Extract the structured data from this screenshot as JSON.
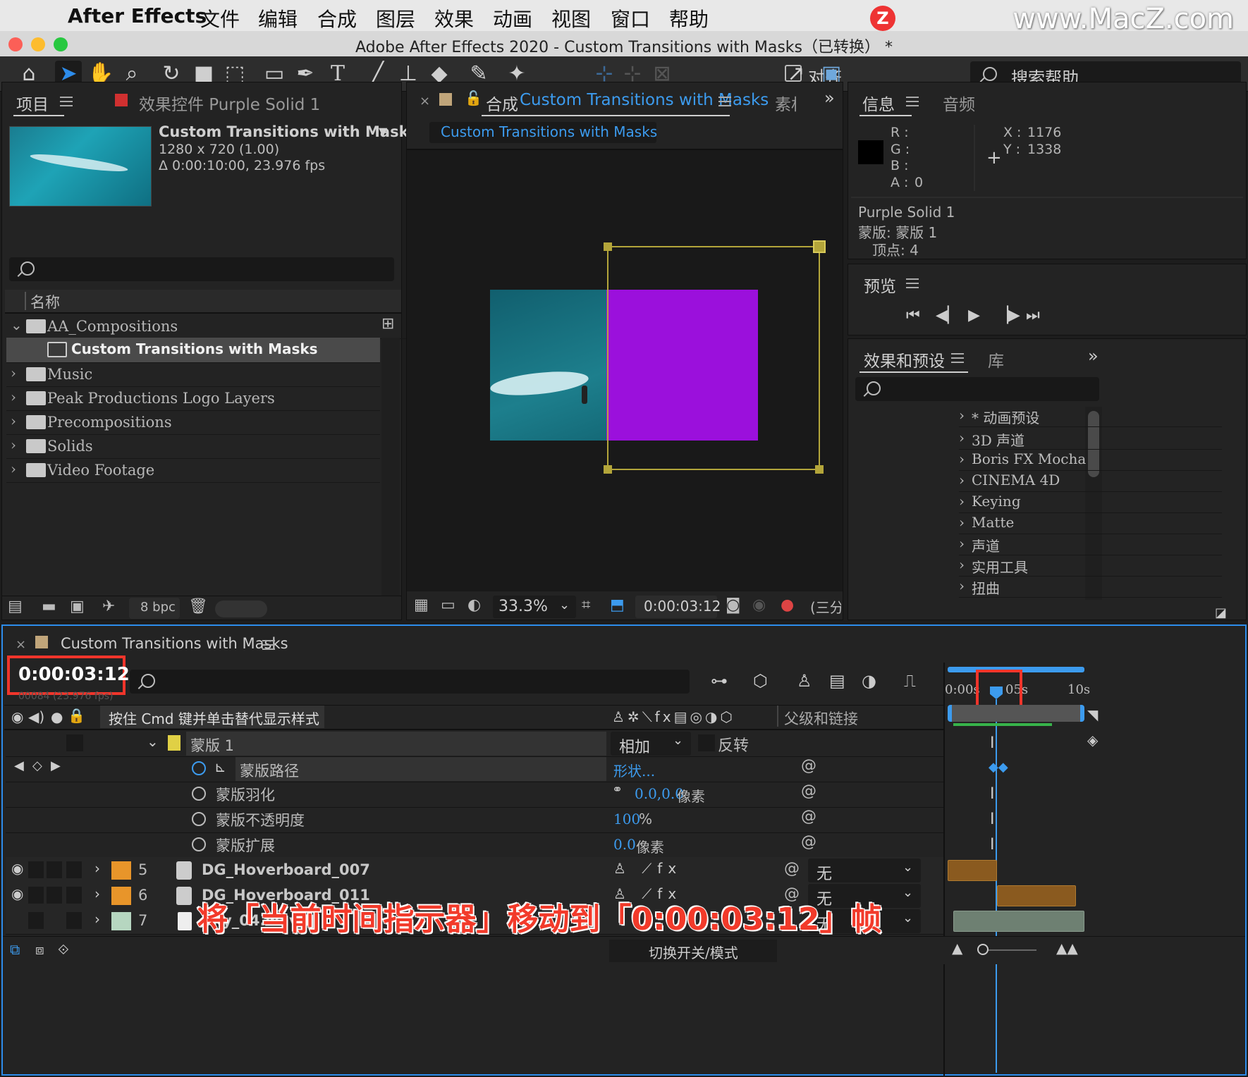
{
  "menubar": {
    "app_name": "After Effects",
    "items": [
      "文件",
      "编辑",
      "合成",
      "图层",
      "效果",
      "动画",
      "视图",
      "窗口",
      "帮助"
    ]
  },
  "watermark": {
    "badge": "Z",
    "text": "www.MacZ.com"
  },
  "window": {
    "title": "Adobe After Effects 2020 - Custom Transitions with Masks（已转换） *"
  },
  "toolbar": {
    "align_label": "对齐",
    "search_help_label": "搜索帮助"
  },
  "project_panel": {
    "tab_label": "项目",
    "effects_tab_label": "效果控件 Purple Solid 1",
    "item_name": "Custom Transitions with Masks",
    "item_dims": "1280 x 720 (1.00)",
    "item_duration": "Δ 0:00:10:00, 23.976 fps",
    "column_name": "名称",
    "folders": [
      {
        "name": "AA_Compositions",
        "expanded": true
      },
      {
        "name": "Music",
        "expanded": false
      },
      {
        "name": "Peak Productions Logo Layers",
        "expanded": false
      },
      {
        "name": "Precompositions",
        "expanded": false
      },
      {
        "name": "Solids",
        "expanded": false
      },
      {
        "name": "Video Footage",
        "expanded": false
      }
    ],
    "selected_item": "Custom Transitions with Masks",
    "bpc": "8 bpc"
  },
  "comp_panel": {
    "tab_prefix": "合成",
    "tab_name": "Custom Transitions with Masks",
    "tab_overflow": "素材",
    "breadcrumb": "Custom Transitions with Masks",
    "zoom": "33.3%",
    "timecode": "0:00:03:12",
    "view_label": "(三分"
  },
  "info_panel": {
    "tab_label": "信息",
    "audio_tab_label": "音频",
    "r_label": "R :",
    "g_label": "G :",
    "b_label": "B :",
    "a_label": "A :",
    "a_value": "0",
    "x_label": "X :",
    "x_value": "1176",
    "y_label": "Y :",
    "y_value": "1338",
    "layer_name": "Purple Solid 1",
    "mask_line": "蒙版: 蒙版 1",
    "vertex_line": "顶点: 4"
  },
  "preview_panel": {
    "tab_label": "预览"
  },
  "effects_panel": {
    "tab_label": "效果和预设",
    "library_tab_label": "库",
    "items": [
      "* 动画预设",
      "3D 声道",
      "Boris FX Mocha",
      "CINEMA 4D",
      "Keying",
      "Matte",
      "声道",
      "实用工具",
      "扭曲"
    ]
  },
  "timeline": {
    "comp_name": "Custom Transitions with Masks",
    "current_time": "0:00:03:12",
    "frame_info": "00084 (23.976 fps)",
    "tooltip": "按住 Cmd 键并单击替代显示样式",
    "parent_header": "父级和链接",
    "ruler": {
      "start": "0:00s",
      "mid": "05s",
      "end": "10s"
    },
    "mask": {
      "name": "蒙版 1",
      "mode": "相加",
      "invert_label": "反转",
      "properties": [
        {
          "name": "蒙版路径",
          "value": "形状..."
        },
        {
          "name": "蒙版羽化",
          "value": "0.0,0.0",
          "unit": "像素"
        },
        {
          "name": "蒙版不透明度",
          "value": "100",
          "unit": "%"
        },
        {
          "name": "蒙版扩展",
          "value": "0.0",
          "unit": "像素"
        }
      ]
    },
    "layers": [
      {
        "num": "5",
        "name": "DG_Hoverboard_007",
        "parent": "无",
        "color": "#e8952a"
      },
      {
        "num": "6",
        "name": "DG_Hoverboard_011",
        "parent": "无",
        "color": "#e8952a"
      },
      {
        "num": "7",
        "name": "Sky_04.wav",
        "parent": "无",
        "color": "#b6d6c0"
      }
    ],
    "footer_toggle": "切换开关/模式"
  },
  "caption": "将「当前时间指示器」移动到「0:00:03:12」帧",
  "colors": {
    "accent": "#2d8ceb",
    "mask_outline": "#b3a53a",
    "solid": "#9b10dc",
    "highlight_box": "#f0352b"
  }
}
